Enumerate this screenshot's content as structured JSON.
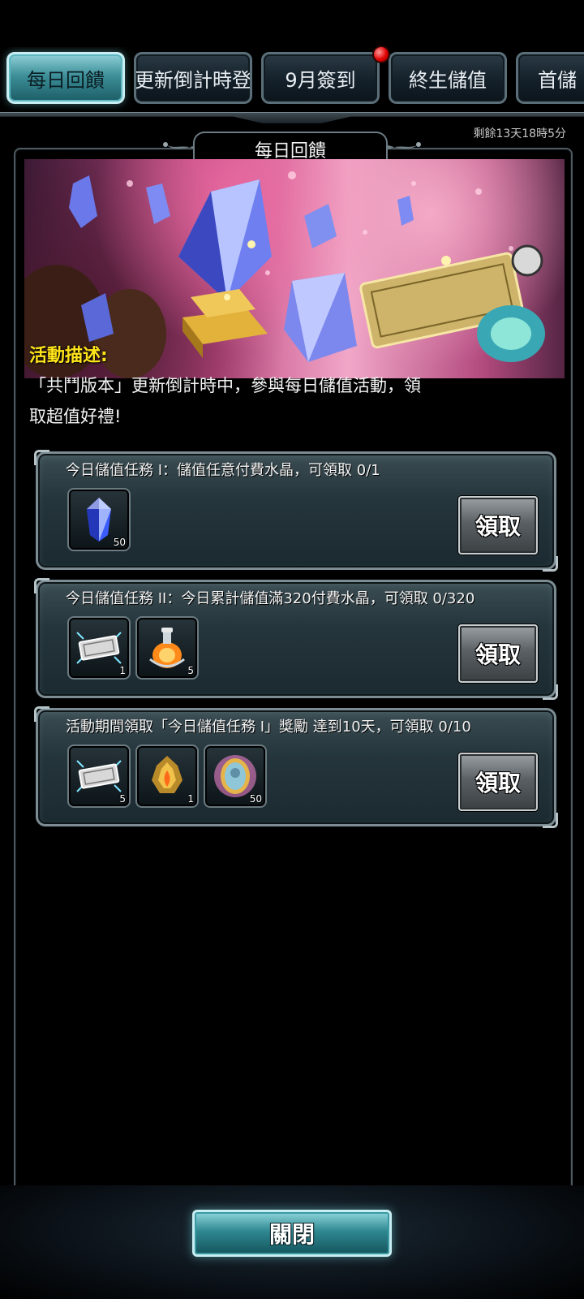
{
  "tabs": [
    {
      "label": "每日回饋",
      "active": true
    },
    {
      "label": "更新倒計時登",
      "active": false
    },
    {
      "label": "9月簽到",
      "active": false,
      "badge": true
    },
    {
      "label": "終生儲值",
      "active": false
    },
    {
      "label": "首儲",
      "active": false
    }
  ],
  "timer": "剩餘13天18時5分",
  "panel": {
    "title": "每日回饋",
    "desc_title": "活動描述:",
    "desc_text": "「共鬥版本」更新倒計時中，參與每日儲值活動，領取超值好禮!"
  },
  "tasks": [
    {
      "title": "今日儲值任務 I：儲值任意付費水晶，可領取 0/1",
      "claim_label": "領取",
      "items": [
        {
          "icon": "blue-crystal-icon",
          "qty": "50"
        }
      ]
    },
    {
      "title": "今日儲值任務 II：今日累計儲值滿320付費水晶，可領取 0/320",
      "claim_label": "領取",
      "items": [
        {
          "icon": "ticket-icon",
          "qty": "1"
        },
        {
          "icon": "potion-icon",
          "qty": "5"
        }
      ]
    },
    {
      "title": "活動期間領取「今日儲值任務 I」獎勵 達到10天，可領取 0/10",
      "claim_label": "領取",
      "items": [
        {
          "icon": "ticket-icon",
          "qty": "5"
        },
        {
          "icon": "golden-relic-icon",
          "qty": "1"
        },
        {
          "icon": "mirror-orb-icon",
          "qty": "50"
        }
      ]
    }
  ],
  "close_label": "關閉",
  "colors": {
    "accent_teal": "#3d8f98",
    "desc_title_yellow": "#ffe41a",
    "badge_red": "#e00000"
  }
}
